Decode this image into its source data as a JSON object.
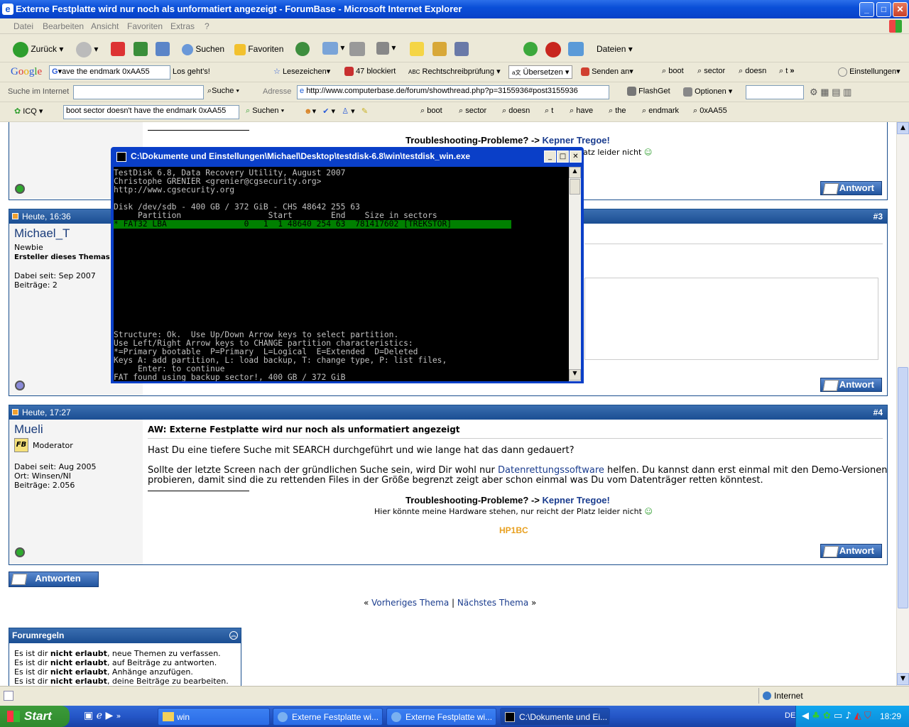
{
  "window": {
    "title": "Externe Festplatte wird nur noch als unformatiert angezeigt - ForumBase - Microsoft Internet Explorer"
  },
  "menu": [
    "Datei",
    "Bearbeiten",
    "Ansicht",
    "Favoriten",
    "Extras",
    "?"
  ],
  "toolbar": {
    "back": "Zurück",
    "search": "Suchen",
    "favorites": "Favoriten",
    "files": "Dateien"
  },
  "googlebar": {
    "query": "ave the endmark 0xAA55",
    "go": "Los geht's!",
    "bookmarks": "Lesezeichen",
    "blocked": "47 blockiert",
    "spell": "Rechtschreibprüfung",
    "translate": "Übersetzen",
    "send": "Senden an",
    "terms": [
      "boot",
      "sector",
      "doesn",
      "t"
    ],
    "settings": "Einstellungen"
  },
  "addressbar": {
    "search_label": "Suche im Internet",
    "search_btn": "Suche",
    "address_label": "Adresse",
    "url": "http://www.computerbase.de/forum/showthread.php?p=3155936#post3155936",
    "flashget": "FlashGet",
    "options": "Optionen"
  },
  "icqbar": {
    "icq": "ICQ",
    "query": "boot sector doesn't have the endmark 0xAA55",
    "search": "Suchen",
    "terms": [
      "boot",
      "sector",
      "doesn",
      "t",
      "have",
      "the",
      "endmark",
      "0xAA55"
    ]
  },
  "top_sig": {
    "trouble_prefix": "Troubleshooting-Probleme? -> ",
    "trouble_link": "Kepner Tregoe!",
    "hw_tail": "atz leider nicht",
    "antwort": "Antwort"
  },
  "post3": {
    "date": "Heute, 16:36",
    "num": "#3",
    "user": "Michael_T",
    "rank": "Newbie",
    "creator": "Ersteller dieses Themas",
    "since": "Dabei seit: Sep 2007",
    "posts": "Beiträge: 2",
    "antwort": "Antwort"
  },
  "post4": {
    "date": "Heute, 17:27",
    "num": "#4",
    "user": "Mueli",
    "rank": "Moderator",
    "since": "Dabei seit: Aug 2005",
    "place": "Ort: Winsen/NI",
    "posts": "Beiträge: 2.056",
    "title": "AW: Externe Festplatte wird nur noch als unformatiert angezeigt",
    "line1": "Hast Du eine tiefere Suche mit SEARCH durchgeführt und wie lange hat das dann gedauert?",
    "line2_a": "Sollte der letzte Screen nach der gründlichen Suche sein, wird Dir wohl nur ",
    "line2_link": "Datenrettungssoftware",
    "line2_b": " helfen. Du kannst dann erst einmal mit den Demo-Versionen",
    "line3": "probieren, damit sind die zu rettenden Files in der Größe begrenzt zeigt aber schon einmal was Du vom Datenträger retten könntest.",
    "trouble_prefix": "Troubleshooting-Probleme? -> ",
    "trouble_link": "Kepner Tregoe!",
    "hw": "Hier könnte meine Hardware stehen, nur reicht der Platz leider nicht",
    "code": "HP1BC",
    "antwort": "Antwort"
  },
  "reply_button": "Antworten",
  "nav": {
    "prev": "Vorheriges Thema",
    "sep": "|",
    "next": "Nächstes Thema"
  },
  "rules": {
    "title": "Forumregeln",
    "items": [
      {
        "a": "Es ist dir ",
        "b": "nicht erlaubt",
        "c": ", neue Themen zu verfassen."
      },
      {
        "a": "Es ist dir ",
        "b": "nicht erlaubt",
        "c": ", auf Beiträge zu antworten."
      },
      {
        "a": "Es ist dir ",
        "b": "nicht erlaubt",
        "c": ", Anhänge anzufügen."
      },
      {
        "a": "Es ist dir ",
        "b": "nicht erlaubt",
        "c": ", deine Beiträge zu bearbeiten."
      }
    ]
  },
  "cmd": {
    "title": "C:\\Dokumente und Einstellungen\\Michael\\Desktop\\testdisk-6.8\\win\\testdisk_win.exe",
    "lines": [
      "TestDisk 6.8, Data Recovery Utility, August 2007",
      "Christophe GRENIER <grenier@cgsecurity.org>",
      "http://www.cgsecurity.org",
      "",
      "Disk /dev/sdb - 400 GB / 372 GiB - CHS 48642 255 63",
      "     Partition                  Start        End    Size in sectors"
    ],
    "selected": "* FAT32 LBA                0   1  1 48640 254 63  781417602 [TREKSTOR]",
    "bottom": [
      "Structure: Ok.  Use Up/Down Arrow keys to select partition.",
      "Use Left/Right Arrow keys to CHANGE partition characteristics:",
      "*=Primary bootable  P=Primary  L=Logical  E=Extended  D=Deleted",
      "Keys A: add partition, L: load backup, T: change type, P: list files,",
      "     Enter: to continue",
      "FAT found using backup sector!, 400 GB / 372 GiB"
    ]
  },
  "status": {
    "zone": "Internet"
  },
  "taskbar": {
    "start": "Start",
    "tasks": [
      "win",
      "Externe Festplatte wi...",
      "Externe Festplatte wi...",
      "C:\\Dokumente und Ei..."
    ],
    "lang": "DE",
    "time": "18:29"
  }
}
